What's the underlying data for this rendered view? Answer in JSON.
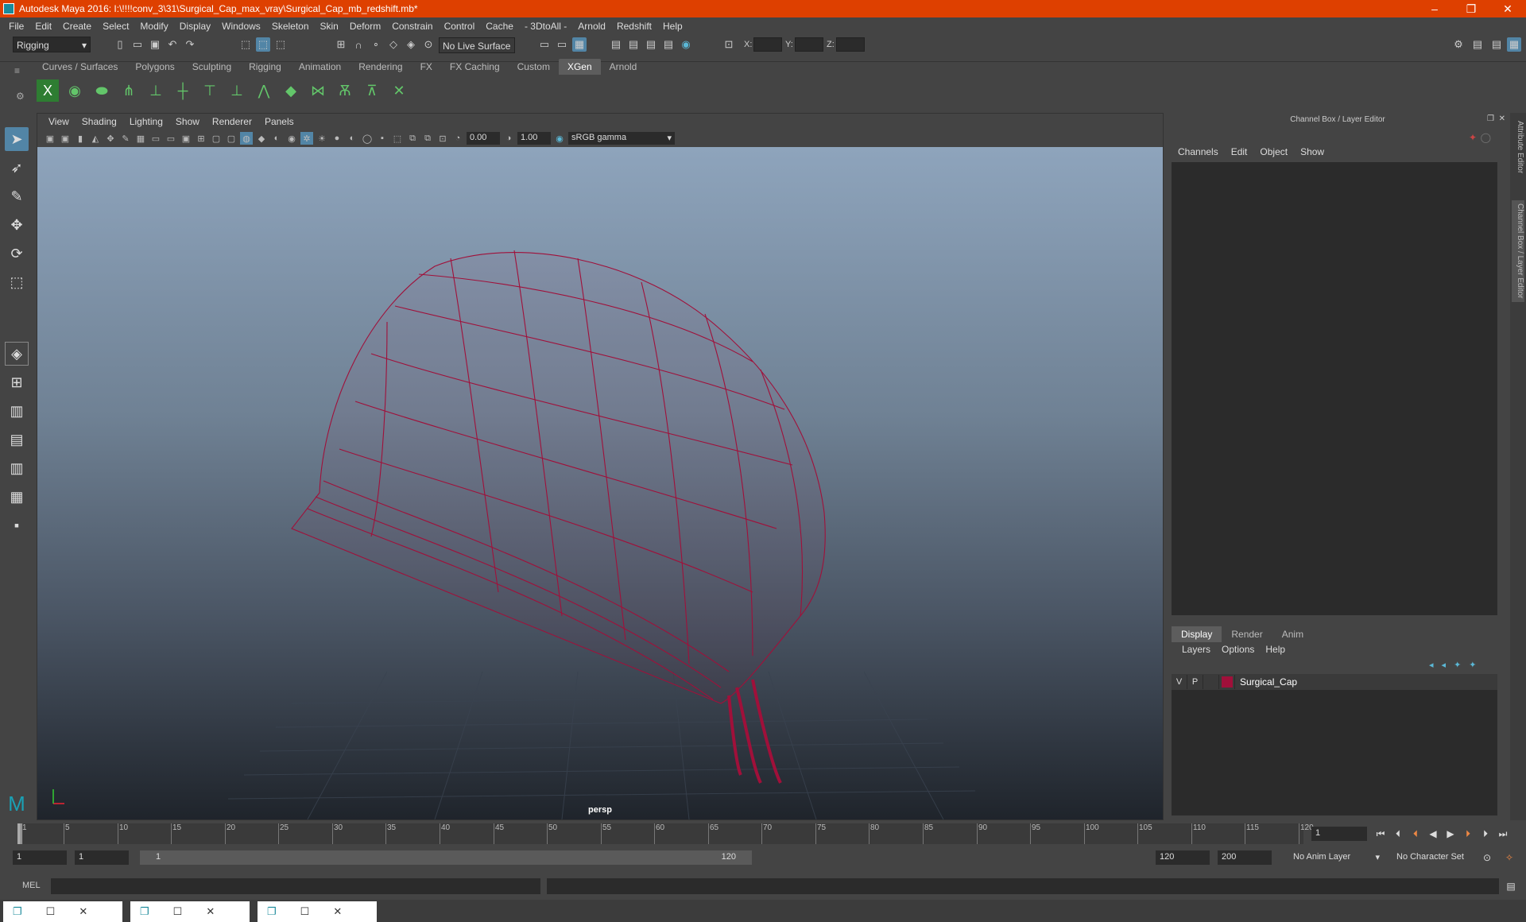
{
  "window": {
    "title": "Autodesk Maya 2016: I:\\!!!!conv_3\\31\\Surgical_Cap_max_vray\\Surgical_Cap_mb_redshift.mb*",
    "minimize": "–",
    "restore": "❐",
    "close": "✕"
  },
  "menubar": [
    "File",
    "Edit",
    "Create",
    "Select",
    "Modify",
    "Display",
    "Windows",
    "Skeleton",
    "Skin",
    "Deform",
    "Constrain",
    "Control",
    "Cache",
    "- 3DtoAll -",
    "Arnold",
    "Redshift",
    "Help"
  ],
  "status": {
    "mode": "Rigging",
    "live_surface": "No Live Surface",
    "x_label": "X:",
    "y_label": "Y:",
    "z_label": "Z:"
  },
  "shelf": {
    "tabs": [
      "Curves / Surfaces",
      "Polygons",
      "Sculpting",
      "Rigging",
      "Animation",
      "Rendering",
      "FX",
      "FX Caching",
      "Custom",
      "XGen",
      "Arnold"
    ],
    "active_tab": "XGen"
  },
  "viewport": {
    "menu": [
      "View",
      "Shading",
      "Lighting",
      "Show",
      "Renderer",
      "Panels"
    ],
    "exposure": "0.00",
    "gamma": "1.00",
    "colorspace": "sRGB gamma",
    "camera": "persp",
    "accent": "#a0103a"
  },
  "channel_box": {
    "title": "Channel Box / Layer Editor",
    "menu": [
      "Channels",
      "Edit",
      "Object",
      "Show"
    ]
  },
  "layer_editor": {
    "tabs": [
      "Display",
      "Render",
      "Anim"
    ],
    "active_tab": "Display",
    "menu": [
      "Layers",
      "Options",
      "Help"
    ],
    "layers": [
      {
        "v": "V",
        "p": "P",
        "name": "Surgical_Cap",
        "color": "#a0103a"
      }
    ]
  },
  "side_tabs": [
    "Attribute Editor",
    "Channel Box / Layer Editor"
  ],
  "timeline": {
    "ticks": [
      "1",
      "5",
      "10",
      "15",
      "20",
      "25",
      "30",
      "35",
      "40",
      "45",
      "50",
      "55",
      "60",
      "65",
      "70",
      "75",
      "80",
      "85",
      "90",
      "95",
      "100",
      "105",
      "110",
      "115",
      "120"
    ],
    "current_frame": "1"
  },
  "range": {
    "start": "1",
    "start2": "1",
    "slider_start": "1",
    "slider_end": "120",
    "end": "120",
    "end2": "200",
    "anim_layer": "No Anim Layer",
    "char_set": "No Character Set"
  },
  "mel": {
    "label": "MEL"
  }
}
